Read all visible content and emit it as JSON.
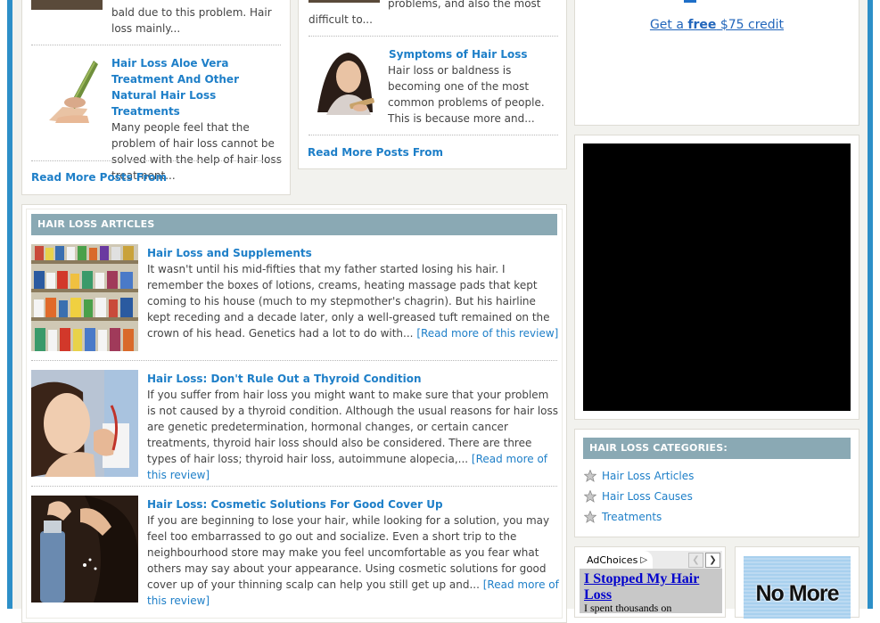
{
  "posts_left": [
    {
      "snippet_tail": "bald due to this problem. Hair loss mainly..."
    },
    {
      "title": "Hair Loss Aloe Vera Treatment And Other Natural Hair Loss Treatments",
      "excerpt": "Many people feel that the problem of hair loss cannot be solved with the help of hair loss treatment..."
    }
  ],
  "posts_left_read_more": "Read More Posts From",
  "posts_mid": [
    {
      "snippet_tail": "problems, and also the most difficult to..."
    },
    {
      "title": "Symptoms of Hair Loss",
      "excerpt": "Hair loss or baldness is becoming one of the most common problems of people. This is because more and..."
    }
  ],
  "posts_mid_read_more": "Read More Posts From",
  "credit_link": {
    "pre": "Get a ",
    "bold": "free",
    "post": " $75 credit"
  },
  "articles_header": "HAIR LOSS ARTICLES",
  "articles": [
    {
      "title": "Hair Loss and Supplements",
      "body": "It wasn't until his mid-fifties that my father started losing his hair. I remember the boxes of lotions, creams, heating massage pads that kept coming to his house (much to my stepmother's chagrin). But his hairline kept receding and a decade later, only a well-greased tuft remained on the crown of his head. Genetics had a lot to do with...",
      "more": "[Read more of this review]"
    },
    {
      "title": "Hair Loss: Don't Rule Out a Thyroid Condition",
      "body": "If you suffer from hair loss you might want to make sure that your problem is not caused by a thyroid condition. Although the usual reasons for hair loss are genetic predetermination, hormonal changes, or certain cancer treatments, thyroid hair loss should also be considered. There are three types of hair loss; thyroid hair loss, autoimmune alopecia,...",
      "more": "[Read more of this review]"
    },
    {
      "title": "Hair Loss: Cosmetic Solutions For Good Cover Up",
      "body": "If you are beginning to lose your hair, while looking for a solution, you may feel too embarrassed to go out and socialize. Even a short trip to the neighbourhood store may make you feel uncomfortable as you fear what others may say about your appearance. Using cosmetic solutions for good cover up of your thinning scalp can help you still get up and...",
      "more": "[Read more of this review]"
    }
  ],
  "categories_header": "HAIR LOSS CATEGORIES:",
  "categories": [
    "Hair Loss Articles",
    "Hair Loss Causes",
    "Treatments"
  ],
  "ad": {
    "adchoices": "AdChoices",
    "headline": "I Stopped My Hair Loss",
    "text": "I spent thousands on",
    "banner_text": "No More"
  },
  "colors": {
    "frame": "#2d8fc8",
    "link": "#1e7fc8",
    "header": "#8aa9b4"
  }
}
